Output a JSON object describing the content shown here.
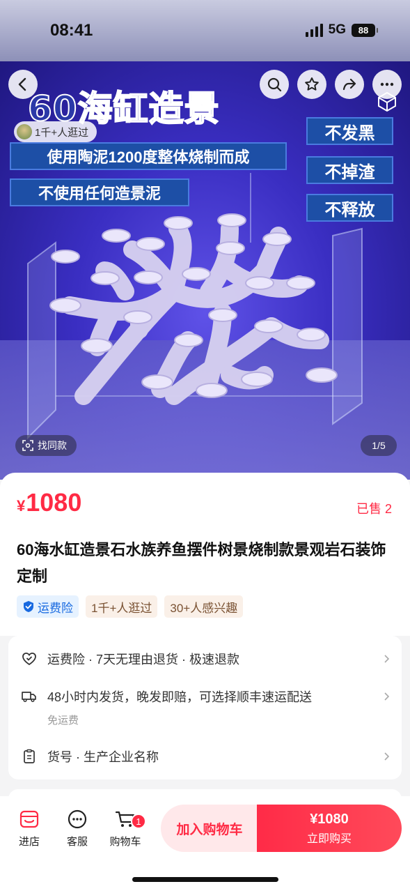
{
  "status_bar": {
    "time": "08:41",
    "network": "5G",
    "battery": "88"
  },
  "hero": {
    "title": "60海缸造景",
    "banner_line_1": "使用陶泥1200度整体烧制而成",
    "banner_line_2": "不使用任何造景泥",
    "right_badges": [
      "不发黑",
      "不掉渣",
      "不释放"
    ],
    "visitor_text": "1千+人逛过",
    "find_same_label": "找同款",
    "page_indicator": "1/5"
  },
  "product": {
    "currency": "¥",
    "price": "1080",
    "sold": "已售 2",
    "title": "60海水缸造景石水族养鱼摆件树景烧制款景观岩石装饰定制",
    "tags": {
      "insurance": "运费险",
      "visits": "1千+人逛过",
      "interest": "30+人感兴趣"
    }
  },
  "services": {
    "guarantee": "运费险 · 7天无理由退货 · 极速退款",
    "shipping": "48小时内发货，晚发即赔，可选择顺丰速运配送",
    "shipping_sub": "免运费",
    "params": "货号 · 生产企业名称"
  },
  "bottom_bar": {
    "store": "进店",
    "service": "客服",
    "cart": "购物车",
    "cart_count": "1",
    "add_to_cart": "加入购物车",
    "buy_price": "¥1080",
    "buy_now": "立即购买"
  },
  "colors": {
    "accent": "#ff2a44",
    "insurance_blue": "#1769e0",
    "hero_blue": "#3a2ec2"
  }
}
